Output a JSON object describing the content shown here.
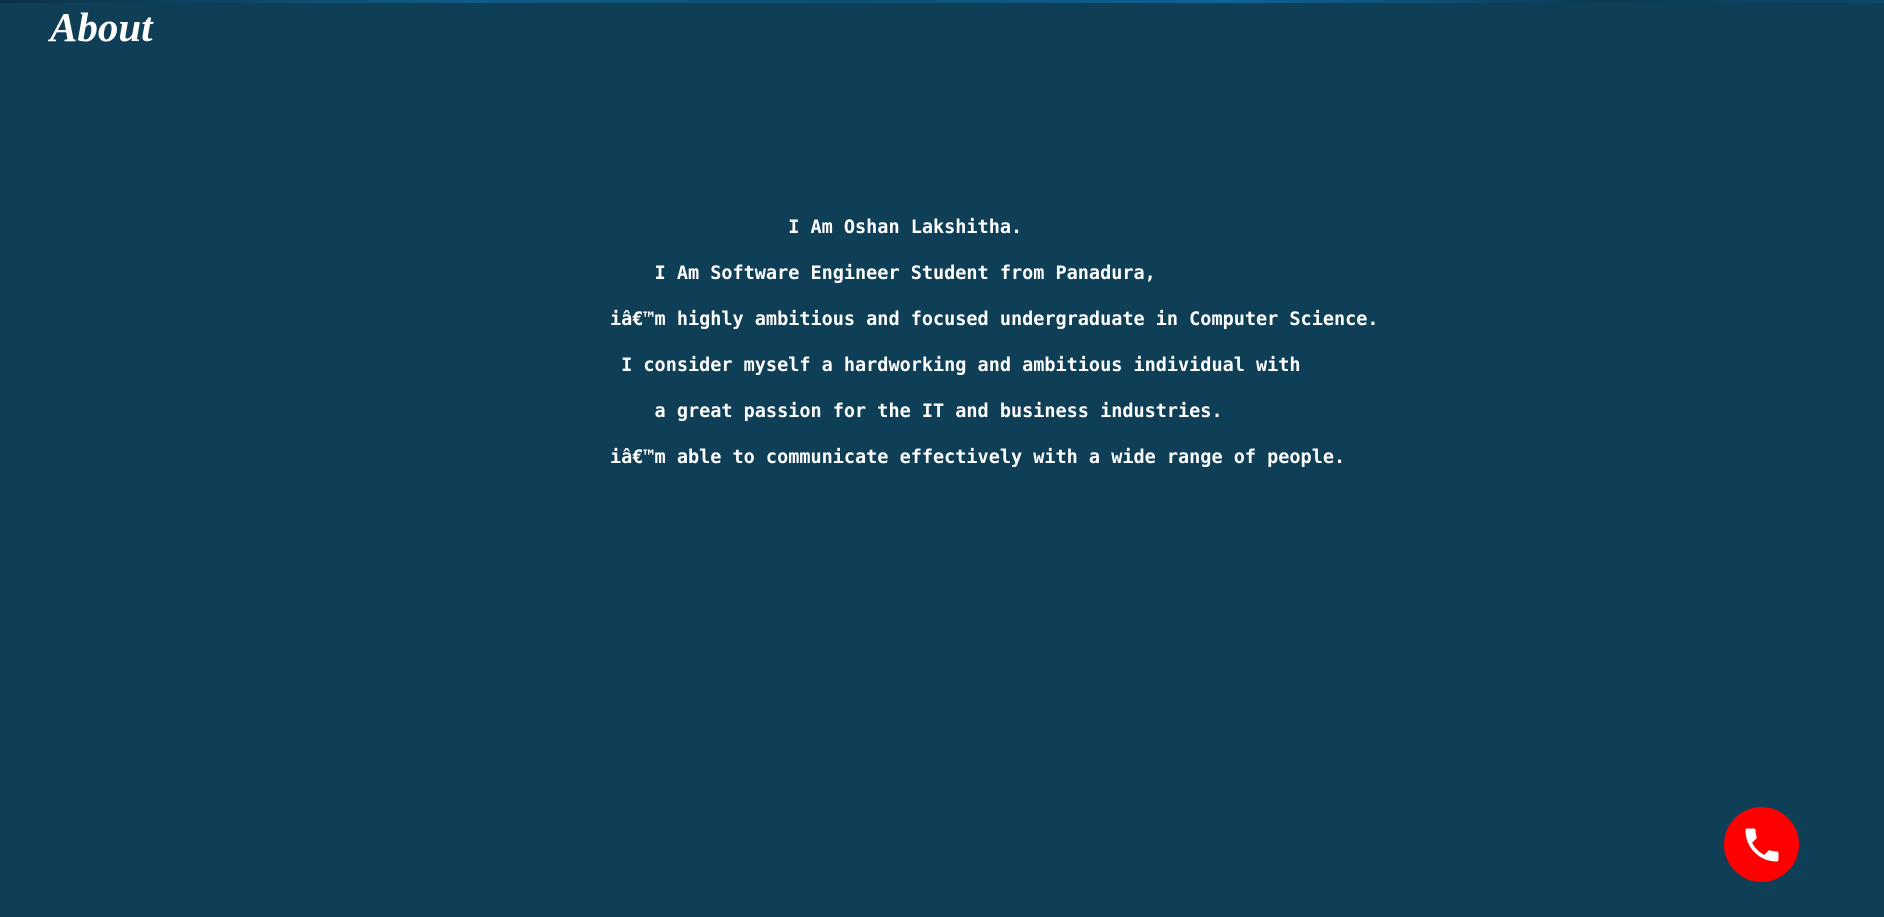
{
  "header": {
    "title": "About"
  },
  "bio": {
    "lines": [
      "                I Am Oshan Lakshitha.",
      "    I Am Software Engineer Student from Panadura,",
      "iâ€™m highly ambitious and focused undergraduate in Computer Science.",
      " I consider myself a hardworking and ambitious individual with",
      "    a great passion for the IT and business industries.",
      "iâ€™m able to communicate effectively with a wide range of people."
    ]
  },
  "call_button": {
    "icon": "phone-icon",
    "color": "#ff0000"
  },
  "colors": {
    "background": "#0e3f57",
    "text": "#ffffff"
  }
}
